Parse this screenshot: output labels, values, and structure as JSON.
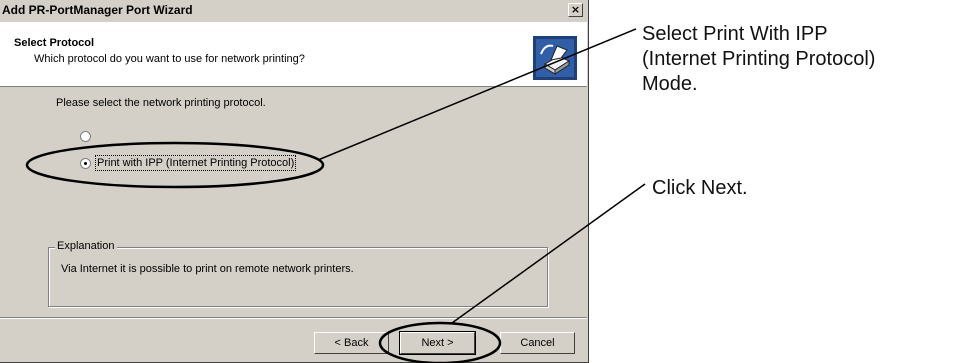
{
  "window": {
    "title": "Add PR-PortManager Port Wizard",
    "close_glyph": "×"
  },
  "header": {
    "title": "Select Protocol",
    "subtitle": "Which protocol do you want to use for network printing?",
    "icon": "wizard-printer-icon"
  },
  "body": {
    "prompt": "Please select the network printing protocol.",
    "options": [
      {
        "label": "",
        "checked": false
      },
      {
        "label": "Print with IPP (Internet Printing Protocol)",
        "checked": true
      }
    ]
  },
  "explanation": {
    "legend": "Explanation",
    "text": "Via Internet it is possible to print on remote network printers."
  },
  "buttons": {
    "back": "< Back",
    "next": "Next >",
    "cancel": "Cancel"
  },
  "annotations": {
    "select_ipp": [
      "Select Print With IPP",
      "(Internet Printing Protocol)",
      "Mode."
    ],
    "click_next": "Click Next."
  }
}
